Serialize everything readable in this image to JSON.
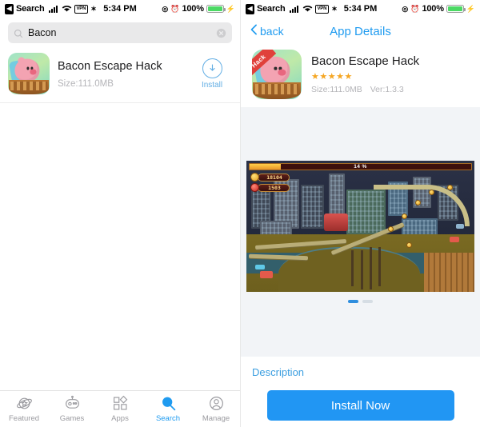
{
  "status_bar": {
    "back_chip": "◀",
    "carrier_label": "Search",
    "signal_icon": "signal-bars-icon",
    "wifi_icon": "wifi-icon",
    "vpn_label": "VPN",
    "location_icon": "location-icon",
    "time": "5:34 PM",
    "rotation_lock_icon": "rotation-lock-icon",
    "alarm_icon": "alarm-icon",
    "battery_percent": "100%",
    "battery_icon": "battery-icon",
    "charging_icon": "charging-bolt-icon"
  },
  "left_panel": {
    "search": {
      "icon": "search-icon",
      "value": "Bacon",
      "placeholder": "Search",
      "clear_icon": "clear-circle-icon"
    },
    "result": {
      "icon_name": "app-icon-bacon-escape",
      "name": "Bacon Escape Hack",
      "size": "Size:111.0MB",
      "install_icon": "download-arrow-icon",
      "install_label": "Install"
    },
    "tabbar": {
      "items": [
        {
          "label": "Featured",
          "icon": "planet-star-icon",
          "active": false
        },
        {
          "label": "Games",
          "icon": "robot-icon",
          "active": false
        },
        {
          "label": "Apps",
          "icon": "shapes-grid-icon",
          "active": false
        },
        {
          "label": "Search",
          "icon": "search-icon",
          "active": true
        },
        {
          "label": "Manage",
          "icon": "person-circle-icon",
          "active": false
        }
      ]
    }
  },
  "right_panel": {
    "nav": {
      "back_icon": "chevron-left-icon",
      "back_label": "back",
      "title": "App Details"
    },
    "detail": {
      "icon_name": "app-icon-bacon-escape",
      "icon_ribbon": "Hack",
      "name": "Bacon Escape Hack",
      "stars": "★★★★★",
      "rating_value": 5,
      "size": "Size:111.0MB",
      "version": "Ver:1.3.3"
    },
    "gallery": {
      "screenshot_name": "game-screenshot-rollercoaster-city",
      "hud": {
        "progress_label": "14 %",
        "progress_percent": 14,
        "coin_counter": "18104",
        "gem_counter": "1503"
      },
      "page_dots": [
        {
          "active": true
        },
        {
          "active": false
        }
      ]
    },
    "description_title": "Description",
    "install_now_label": "Install Now"
  },
  "colors": {
    "accent_blue": "#2196f3",
    "link_blue": "#1f9bf0",
    "muted_gray": "#b4b4b8",
    "battery_green": "#4cd964",
    "star_orange": "#f5a623"
  }
}
